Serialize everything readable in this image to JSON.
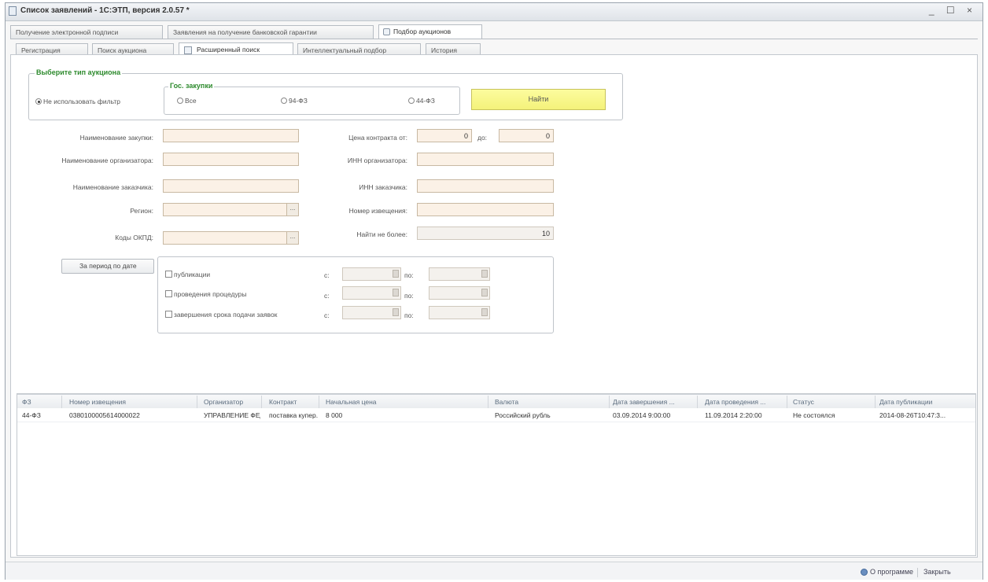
{
  "window": {
    "title": "Список заявлений - 1С:ЭТП, версия 2.0.57 *",
    "controls": "_ ☐ ×"
  },
  "top_tabs": [
    {
      "label": "Получение электронной подписи"
    },
    {
      "label": "Заявления на получение банковской гарантии"
    },
    {
      "label": "Подбор аукционов"
    }
  ],
  "sub_tabs": [
    {
      "label": "Регистрация"
    },
    {
      "label": "Поиск аукциона"
    },
    {
      "label": "Расширенный поиск"
    },
    {
      "label": "Интеллектуальный подбор"
    },
    {
      "label": "История"
    }
  ],
  "auction_type": {
    "title": "Выберите тип аукциона",
    "no_filter_label": "Не использовать фильтр",
    "gos_title": "Гос. закупки",
    "options": [
      "Все",
      "94-ФЗ",
      "44-ФЗ"
    ],
    "find_button": "Найти"
  },
  "form": {
    "purchase_name_label": "Наименование закупки:",
    "organizer_name_label": "Наименование организатора:",
    "customer_name_label": "Наименование заказчика:",
    "region_label": "Регион:",
    "okpd_label": "Коды ОКПД:",
    "price_from_label": "Цена контракта от:",
    "price_from_value": "0",
    "price_to_label": "до:",
    "price_to_value": "0",
    "organizer_inn_label": "ИНН организатора:",
    "customer_inn_label": "ИНН заказчика:",
    "notice_number_label": "Номер извещения:",
    "max_results_label": "Найти не более:",
    "max_results_value": "10",
    "picker_glyph": "..."
  },
  "period": {
    "button_label": "За период по дате",
    "rows": [
      {
        "label": "публикации",
        "from": "с:",
        "to": "по:"
      },
      {
        "label": "проведения процедуры",
        "from": "с:",
        "to": "по:"
      },
      {
        "label": "завершения срока подачи заявок",
        "from": "с:",
        "to": "по:"
      }
    ]
  },
  "table": {
    "columns": [
      "ФЗ",
      "Номер извещения",
      "Организатор",
      "Контракт",
      "Начальная цена",
      "Валюта",
      "Дата завершения ...",
      "Дата проведения ...",
      "Статус",
      "Дата публикации"
    ],
    "rows": [
      [
        "44-ФЗ",
        "0380100005614000022",
        "УПРАВЛЕНИЕ ФЕДЕ...",
        "поставка купер...",
        "8 000",
        "Российский рубль",
        "03.09.2014 9:00:00",
        "11.09.2014 2:20:00",
        "Не состоялся",
        "2014-08-26T10:47:3..."
      ]
    ]
  },
  "status_bar": {
    "about_label": "О программе",
    "close_label": "Закрыть"
  }
}
